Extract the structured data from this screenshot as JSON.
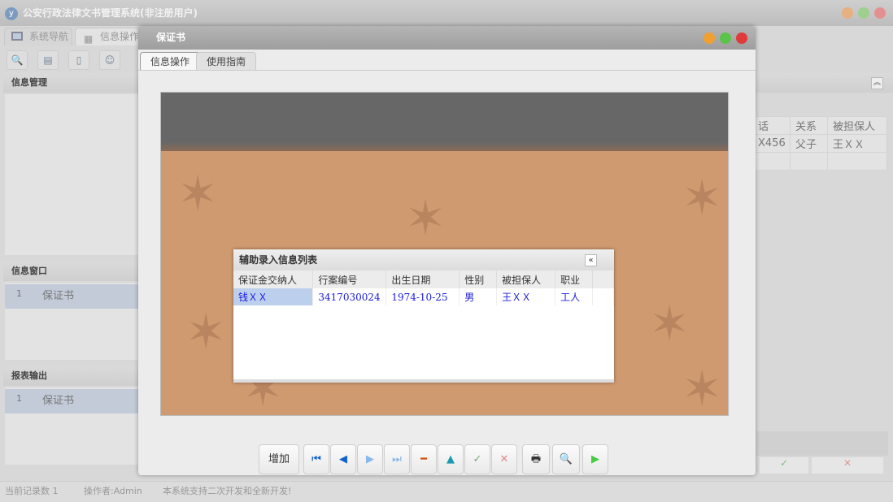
{
  "app": {
    "title": "公安行政法律文书管理系统(非注册用户)",
    "logo": "y"
  },
  "main_tabs": [
    {
      "label": "系统导航",
      "icon": "monitor-icon"
    },
    {
      "label": "信息操作",
      "icon": "grid-icon"
    }
  ],
  "panels": {
    "info_manage": "信息管理",
    "info_window": {
      "title": "信息窗口",
      "rows": [
        {
          "no": "1",
          "name": "保证书"
        }
      ]
    },
    "report_output": {
      "title": "报表输出",
      "rows": [
        {
          "no": "1",
          "name": "保证书"
        }
      ]
    }
  },
  "right_grid": {
    "headers": [
      "话",
      "关系",
      "被担保人"
    ],
    "rows": [
      [
        "X456",
        "父子",
        "王ＸＸ"
      ]
    ]
  },
  "status": {
    "records": "当前记录数 1",
    "operator": "操作者:Admin",
    "message": "本系统支持二次开发和全新开发!"
  },
  "modal": {
    "title": "保证书",
    "tabs": [
      "信息操作",
      "使用指南"
    ],
    "dialog": {
      "title": "辅助录入信息列表",
      "headers": [
        "保证金交纳人",
        "行案编号",
        "出生日期",
        "性别",
        "被担保人",
        "职业"
      ],
      "rows": [
        [
          "钱ＸＸ",
          "3417030024",
          "1974-10-25",
          "男",
          "王ＸＸ",
          "工人"
        ]
      ]
    },
    "buttons": {
      "add": "增加"
    }
  },
  "colors": {
    "link_blue": "#1a1ae0",
    "selection": "#bcd0ee",
    "canvas": "#cf9a70"
  }
}
